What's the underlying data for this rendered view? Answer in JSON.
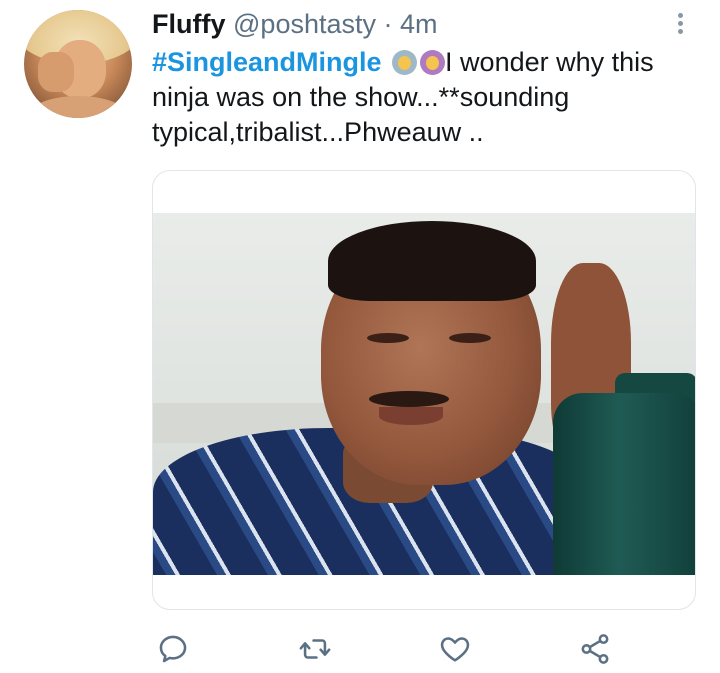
{
  "tweet": {
    "author": {
      "name": "Fluffy",
      "handle": "@poshtasty",
      "separator": "·",
      "time": "4m"
    },
    "text": {
      "hashtag": "#SingleandMingle",
      "emojis": [
        "person-gesturing-ok-emoji",
        "woman-gesturing-ok-emoji"
      ],
      "body": "I wonder why this ninja was on the show...**sounding typical,tribalist...Phweauw .."
    },
    "actions": [
      "reply-icon",
      "retweet-icon",
      "like-icon",
      "share-icon"
    ]
  },
  "colors": {
    "hashtag": "#1b95e0",
    "secondary_text": "#5b7083",
    "icon": "#5b7083",
    "border": "#dfe5ea"
  }
}
